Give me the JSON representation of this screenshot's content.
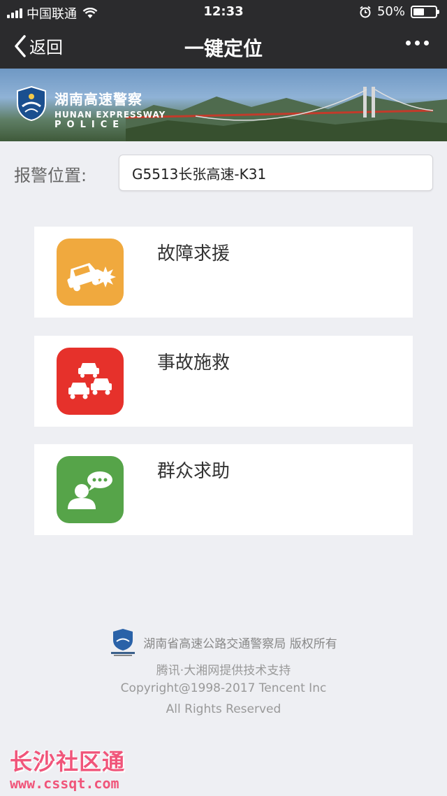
{
  "status_bar": {
    "carrier": "中国联通",
    "time": "12:33",
    "battery": "50%",
    "battery_level": 0.5
  },
  "nav": {
    "back_label": "返回",
    "title": "一键定位"
  },
  "banner": {
    "cn": "湖南高速警察",
    "en1": "HUNAN EXPRESSWAY",
    "en2": "POLICE"
  },
  "location": {
    "label": "报警位置:",
    "value": "G5513长张高速-K31"
  },
  "options": [
    {
      "label": "故障求援",
      "icon": "car-breakdown-icon",
      "color": "#f0a93e"
    },
    {
      "label": "事故施救",
      "icon": "car-accident-icon",
      "color": "#e6312b"
    },
    {
      "label": "群众求助",
      "icon": "person-chat-icon",
      "color": "#56a449"
    }
  ],
  "footer": {
    "org": "湖南省高速公路交通警察局 版权所有",
    "support": "腾讯·大湘网提供技术支持",
    "copyright": "Copyright@1998-2017 Tencent Inc",
    "rights": "All Rights Reserved"
  },
  "watermark": {
    "text": "长沙社区通",
    "url": "www.cssqt.com"
  }
}
